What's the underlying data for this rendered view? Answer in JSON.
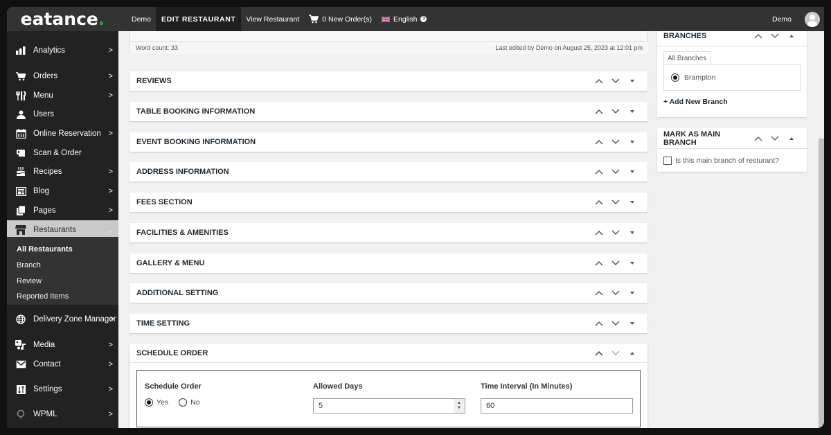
{
  "topbar": {
    "logo": "eatance",
    "logo_dot": ".",
    "site_name": "Demo",
    "active_page": "EDIT RESTAURANT",
    "view_link": "View Restaurant",
    "orders": "0 New Order(s)",
    "language": "English",
    "help": "?",
    "user": "Demo",
    "icons": {
      "cart": "cart-icon",
      "flag": "uk-flag-icon",
      "help": "help-circle-icon",
      "avatar": "user-avatar-icon"
    }
  },
  "sidebar": {
    "items": [
      {
        "label": "Analytics",
        "icon": "bar-chart-icon",
        "has_arrow": true
      },
      {
        "label": "Orders",
        "icon": "cart-icon",
        "has_arrow": true
      },
      {
        "label": "Menu",
        "icon": "utensils-icon",
        "has_arrow": true
      },
      {
        "label": "Users",
        "icon": "user-icon",
        "has_arrow": false
      },
      {
        "label": "Online Reservation",
        "icon": "calendar-icon",
        "has_arrow": true
      },
      {
        "label": "Scan & Order",
        "icon": "scan-icon",
        "has_arrow": false
      },
      {
        "label": "Recipes",
        "icon": "cake-icon",
        "has_arrow": true
      },
      {
        "label": "Blog",
        "icon": "blog-icon",
        "has_arrow": true
      },
      {
        "label": "Pages",
        "icon": "pages-icon",
        "has_arrow": true
      },
      {
        "label": "Restaurants",
        "icon": "store-icon",
        "has_arrow": true,
        "current": true
      },
      {
        "label": "Delivery Zone Manager",
        "icon": "globe-icon",
        "has_arrow": true
      },
      {
        "label": "Media",
        "icon": "media-icon",
        "has_arrow": true
      },
      {
        "label": "Contact",
        "icon": "envelope-icon",
        "has_arrow": true
      },
      {
        "label": "Settings",
        "icon": "settings-icon",
        "has_arrow": true
      },
      {
        "label": "WPML",
        "icon": "wpml-icon",
        "has_arrow": true
      }
    ],
    "arrow": ">",
    "arrow_open": "⌄",
    "submenu": [
      "All Restaurants",
      "Branch",
      "Review",
      "Reported Items"
    ]
  },
  "editor": {
    "word_count": "Word count: 33",
    "last_edited": "Last edited by Demo on August 25, 2023 at 12:01 pm"
  },
  "panels": [
    "REVIEWS",
    "TABLE BOOKING INFORMATION",
    "EVENT BOOKING INFORMATION",
    "ADDRESS INFORMATION",
    "FEES SECTION",
    "FACILITIES & AMENITIES",
    "GALLERY & MENU",
    "ADDITIONAL SETTING",
    "TIME SETTING"
  ],
  "schedule": {
    "title": "SCHEDULE ORDER",
    "schedule_order_label": "Schedule Order",
    "yes": "Yes",
    "no": "No",
    "selected": "Yes",
    "allowed_days_label": "Allowed Days",
    "allowed_days_value": "5",
    "interval_label": "Time Interval (In Minutes)",
    "interval_value": "60"
  },
  "branches": {
    "title": "BRANCHES",
    "tab": "All Branches",
    "selected_branch": "Brampton",
    "add_link": "+ Add New Branch"
  },
  "main_branch": {
    "title": "MARK AS MAIN BRANCH",
    "checkbox_label": "Is this main branch of resturant?",
    "checked": false
  }
}
